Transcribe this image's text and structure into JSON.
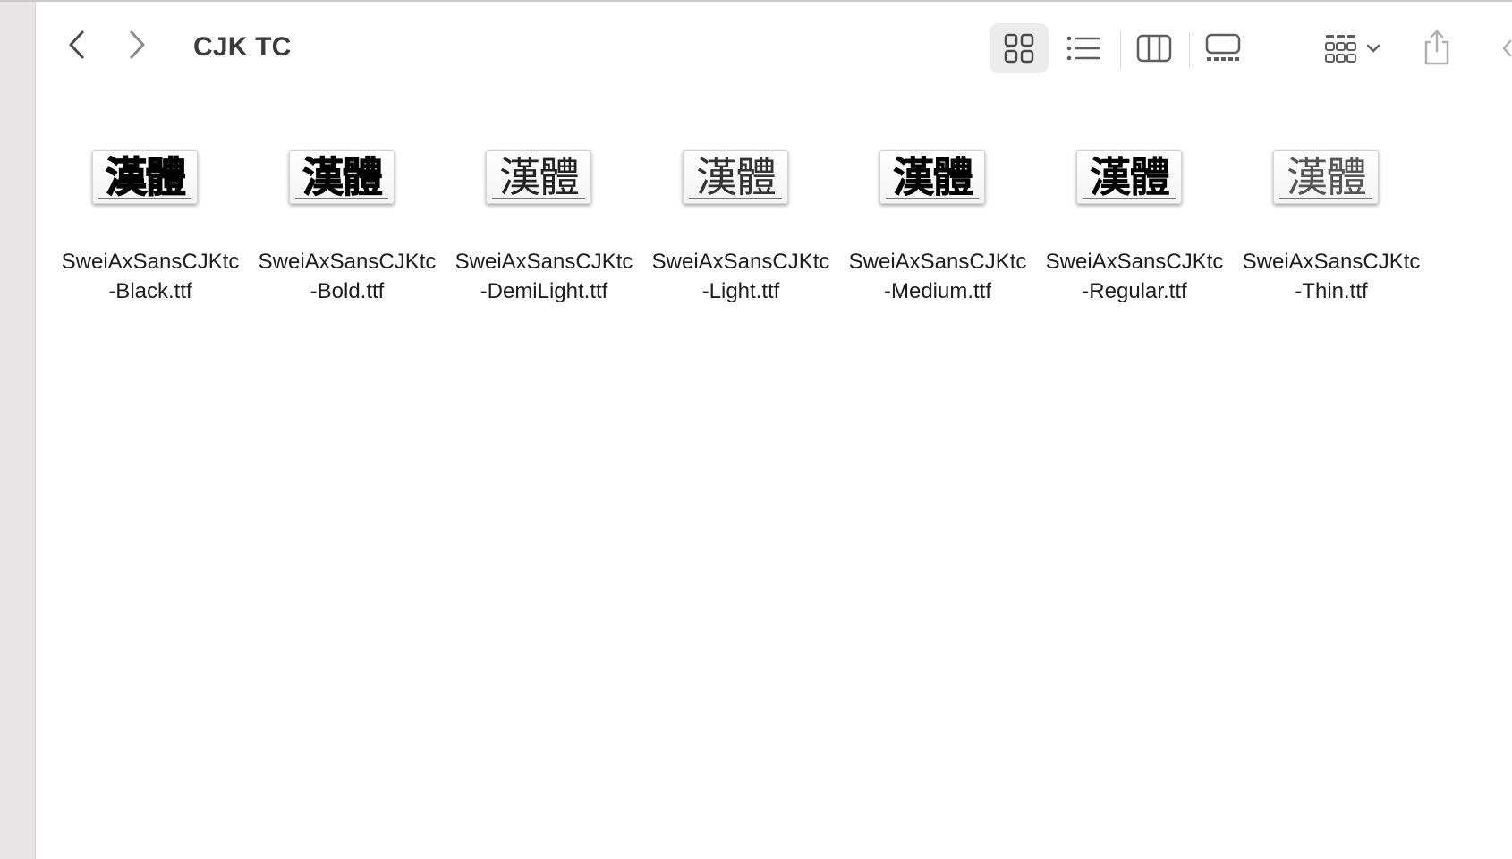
{
  "window": {
    "title": "CJK TC"
  },
  "toolbar": {
    "back_icon": "chevron-left-icon",
    "forward_icon": "chevron-right-icon",
    "views": [
      {
        "name": "icon-view",
        "icon": "grid-icon",
        "active": true
      },
      {
        "name": "list-view",
        "icon": "list-icon",
        "active": false
      },
      {
        "name": "column-view",
        "icon": "columns-icon",
        "active": false
      },
      {
        "name": "gallery-view",
        "icon": "gallery-icon",
        "active": false
      }
    ],
    "group_icon": "group-grid-icon",
    "share_icon": "share-icon"
  },
  "files": [
    {
      "preview": "漢體",
      "weight": "black",
      "name_line1": "SweiAxSansCJKtc",
      "name_line2": "-Black.ttf"
    },
    {
      "preview": "漢體",
      "weight": "bold",
      "name_line1": "SweiAxSansCJKtc",
      "name_line2": "-Bold.ttf"
    },
    {
      "preview": "漢體",
      "weight": "demilight",
      "name_line1": "SweiAxSansCJKtc",
      "name_line2": "-DemiLight.ttf"
    },
    {
      "preview": "漢體",
      "weight": "light",
      "name_line1": "SweiAxSansCJKtc",
      "name_line2": "-Light.ttf"
    },
    {
      "preview": "漢體",
      "weight": "medium",
      "name_line1": "SweiAxSansCJKtc",
      "name_line2": "-Medium.ttf"
    },
    {
      "preview": "漢體",
      "weight": "regular",
      "name_line1": "SweiAxSansCJKtc",
      "name_line2": "-Regular.ttf"
    },
    {
      "preview": "漢體",
      "weight": "thin",
      "name_line1": "SweiAxSansCJKtc",
      "name_line2": "-Thin.ttf"
    }
  ],
  "colors": {
    "sidebar": "#e9e5e6",
    "active_view_bg": "#ececec",
    "icon_gray": "#5e5e5e"
  }
}
